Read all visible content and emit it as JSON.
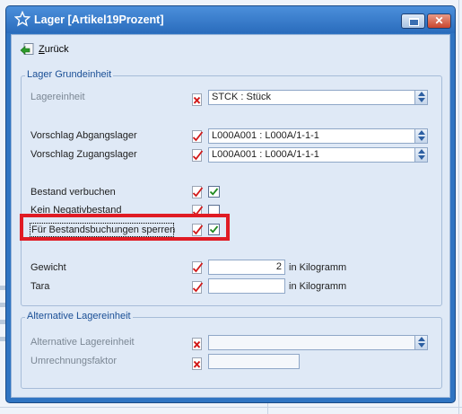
{
  "window": {
    "title": "Lager [Artikel19Prozent]"
  },
  "toolbar": {
    "back_label_first": "Z",
    "back_label_rest": "urück"
  },
  "group1": {
    "legend": "Lager Grundeinheit",
    "lagereinheit": {
      "label": "Lagereinheit",
      "value": "STCK     : Stück"
    },
    "abgangslager": {
      "label": "Vorschlag Abgangslager",
      "value": "L000A001     : L000A/1-1-1"
    },
    "zugangslager": {
      "label": "Vorschlag Zugangslager",
      "value": "L000A001     : L000A/1-1-1"
    },
    "bestand_verbuchen": {
      "label": "Bestand verbuchen",
      "checked": true
    },
    "kein_negativbestand": {
      "label": "Kein Negativbestand",
      "checked": false
    },
    "bestandsbuchungen_sperren": {
      "label": "Für Bestandsbuchungen sperren",
      "checked": true
    },
    "gewicht": {
      "label": "Gewicht",
      "value": "2",
      "unit": "in Kilogramm"
    },
    "tara": {
      "label": "Tara",
      "value": "",
      "unit": "in Kilogramm"
    }
  },
  "group2": {
    "legend": "Alternative Lagereinheit",
    "alt_lagereinheit": {
      "label": "Alternative Lagereinheit",
      "value": ""
    },
    "umrechnungsfaktor": {
      "label": "Umrechnungsfaktor",
      "value": ""
    }
  },
  "colors": {
    "title_bar": "#2f74c2",
    "highlight": "#e01b24",
    "legend_text": "#1a4f96"
  }
}
